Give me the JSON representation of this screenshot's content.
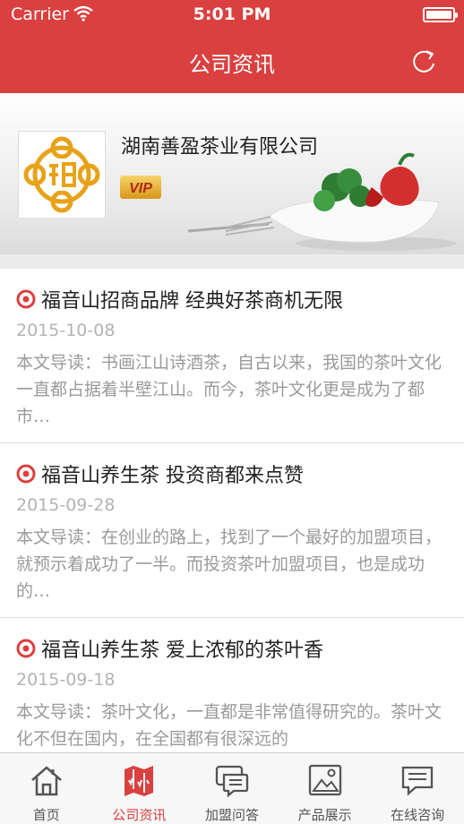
{
  "status_bar": {
    "carrier": "Carrier",
    "time": "5:01 PM"
  },
  "nav": {
    "title": "公司资讯"
  },
  "banner": {
    "company_name": "湖南善盈茶业有限公司",
    "vip_label": "VIP"
  },
  "articles": [
    {
      "title": "福音山招商品牌 经典好茶商机无限",
      "date": "2015-10-08",
      "summary": "本文导读：书画江山诗酒茶，自古以来，我国的茶叶文化一直都占据着半壁江山。而今，茶叶文化更是成为了都市…"
    },
    {
      "title": "福音山养生茶 投资商都来点赞",
      "date": "2015-09-28",
      "summary": "本文导读：在创业的路上，找到了一个最好的加盟项目，就预示着成功了一半。而投资茶叶加盟项目，也是成功的…"
    },
    {
      "title": "福音山养生茶 爱上浓郁的茶叶香",
      "date": "2015-09-18",
      "summary": "本文导读：茶叶文化，一直都是非常值得研究的。茶叶文化不但在国内，在全国都有很深远的"
    }
  ],
  "tabs": [
    {
      "label": "首页",
      "icon": "home-icon"
    },
    {
      "label": "公司资讯",
      "icon": "map-icon"
    },
    {
      "label": "加盟问答",
      "icon": "chat-icon"
    },
    {
      "label": "产品展示",
      "icon": "image-icon"
    },
    {
      "label": "在线咨询",
      "icon": "message-icon"
    }
  ],
  "colors": {
    "brand": "#d9403f",
    "active_tab": "#d9403f"
  }
}
